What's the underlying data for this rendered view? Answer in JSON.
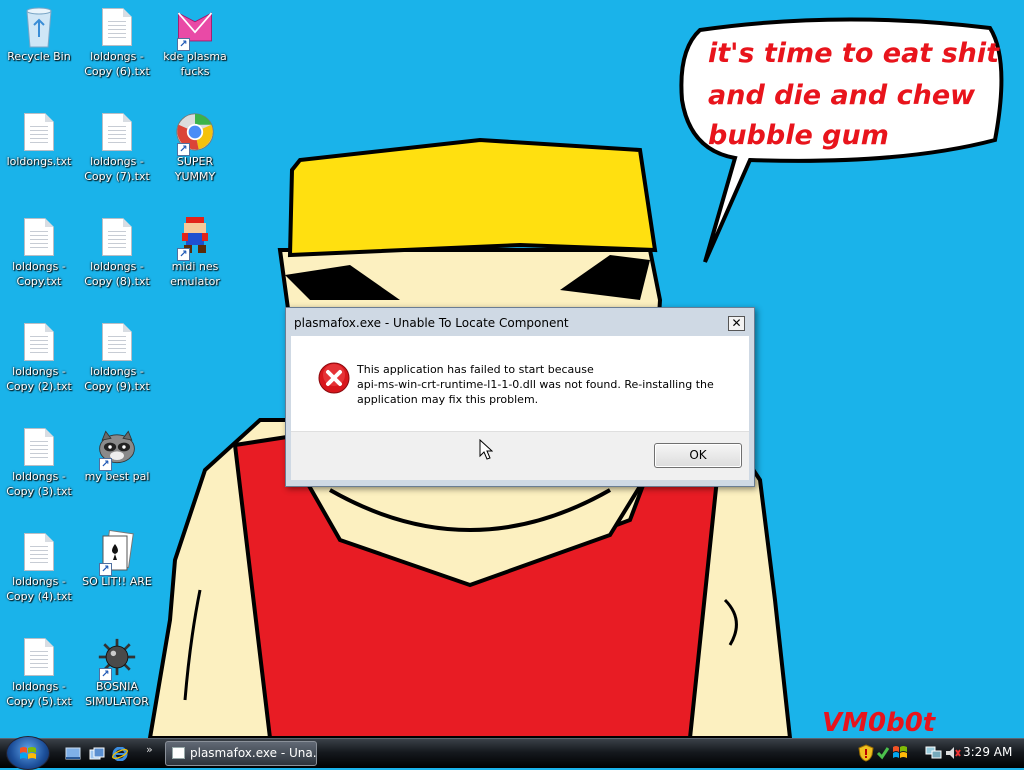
{
  "wallpaper": {
    "speech_bubble": [
      "it's time to eat shit",
      "and die and chew",
      "bubble gum"
    ],
    "signature": "VM0b0t",
    "colors": {
      "sky": "#1ab3ea",
      "hat": "#ffe010",
      "shirt": "#e81c24",
      "skin": "#fcf0c0",
      "text": "#e8141c"
    }
  },
  "desktop_icons": [
    {
      "label": "Recycle Bin",
      "icon": "recycle-bin-icon"
    },
    {
      "label": "loldongs - Copy (6).txt",
      "icon": "text-file-icon"
    },
    {
      "label": "kde plasma fucks",
      "icon": "kde-shortcut-icon"
    },
    {
      "label": "loldongs.txt",
      "icon": "text-file-icon"
    },
    {
      "label": "loldongs - Copy (7).txt",
      "icon": "text-file-icon"
    },
    {
      "label": "SUPER YUMMY",
      "icon": "chrome-shortcut-icon"
    },
    {
      "label": "loldongs - Copy.txt",
      "icon": "text-file-icon"
    },
    {
      "label": "loldongs - Copy (8).txt",
      "icon": "text-file-icon"
    },
    {
      "label": "midi nes emulator",
      "icon": "mario-shortcut-icon"
    },
    {
      "label": "loldongs - Copy (2).txt",
      "icon": "text-file-icon"
    },
    {
      "label": "loldongs - Copy (9).txt",
      "icon": "text-file-icon"
    },
    {
      "label": "loldongs - Copy (3).txt",
      "icon": "text-file-icon"
    },
    {
      "label": "my best pal",
      "icon": "raccoon-shortcut-icon"
    },
    {
      "label": "loldongs - Copy (4).txt",
      "icon": "text-file-icon"
    },
    {
      "label": "SO LIT!! ARE",
      "icon": "solitaire-shortcut-icon"
    },
    {
      "label": "loldongs - Copy (5).txt",
      "icon": "text-file-icon"
    },
    {
      "label": "BOSNIA SIMULATOR",
      "icon": "minesweeper-shortcut-icon"
    }
  ],
  "dialog": {
    "title": "plasmafox.exe - Unable To Locate Component",
    "close_label": "✕",
    "message": [
      "This application has failed to start because",
      "api-ms-win-crt-runtime-l1-1-0.dll was not found. Re-installing the",
      "application may fix this problem."
    ],
    "ok_label": "OK",
    "icon": "error-icon"
  },
  "taskbar": {
    "start_icon": "windows-start-icon",
    "quick_launch": [
      "show-desktop-icon",
      "switch-windows-icon",
      "internet-explorer-icon"
    ],
    "overflow": "»",
    "task_button": "plasmafox.exe - Una...",
    "tray_icons": [
      "security-shield-icon",
      "checkmark-icon",
      "flag-icon",
      "network-icon",
      "volume-icon"
    ],
    "clock": "3:29 AM"
  }
}
